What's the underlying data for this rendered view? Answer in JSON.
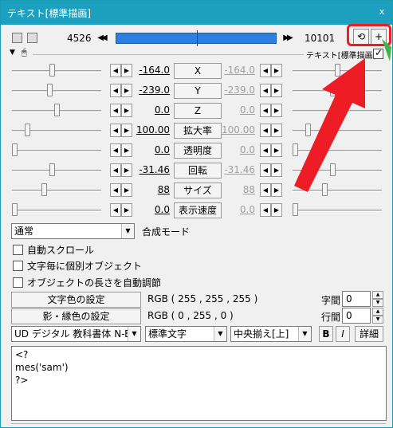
{
  "window": {
    "title": "テキスト[標準描画]",
    "close_glyph": "x"
  },
  "toolbar": {
    "frame_start": "4526",
    "frame_end": "10101",
    "rewind_glyph": "◀◀",
    "forward_glyph": "▶▶",
    "loop_glyph": "⟲",
    "add_glyph": "+"
  },
  "filter_header": {
    "label": "テキスト[標準描画]"
  },
  "params": [
    {
      "name": "X",
      "value": "-164.0",
      "end_value": "-164.0",
      "left_level": 0.45,
      "right_level": 0.5
    },
    {
      "name": "Y",
      "value": "-239.0",
      "end_value": "-239.0",
      "left_level": 0.42,
      "right_level": 0.45
    },
    {
      "name": "Z",
      "value": "0.0",
      "end_value": "0.0",
      "left_level": 0.5,
      "right_level": 0.5
    },
    {
      "name": "拡大率",
      "value": "100.00",
      "end_value": "100.00",
      "left_level": 0.15,
      "right_level": 0.15
    },
    {
      "name": "透明度",
      "value": "0.0",
      "end_value": "0.0",
      "left_level": 0.0,
      "right_level": 0.0
    },
    {
      "name": "回転",
      "value": "-31.46",
      "end_value": "-31.46",
      "left_level": 0.45,
      "right_level": 0.45
    },
    {
      "name": "サイズ",
      "value": "88",
      "end_value": "88",
      "left_level": 0.35,
      "right_level": 0.35
    },
    {
      "name": "表示速度",
      "value": "0.0",
      "end_value": "0.0",
      "left_level": 0.0,
      "right_level": 0.0
    }
  ],
  "blend": {
    "selected": "通常",
    "label": "合成モード"
  },
  "checkboxes": [
    {
      "label": "自動スクロール",
      "checked": false
    },
    {
      "label": "文字毎に個別オブジェクト",
      "checked": false
    },
    {
      "label": "オブジェクトの長さを自動調節",
      "checked": false
    }
  ],
  "colors": {
    "text_button": "文字色の設定",
    "text_rgb": "RGB ( 255 , 255 , 255 )",
    "shadow_button": "影・縁色の設定",
    "shadow_rgb": "RGB ( 0 , 255 , 0 )",
    "char_spacing_label": "字間",
    "char_spacing_value": "0",
    "line_spacing_label": "行間",
    "line_spacing_value": "0"
  },
  "font_row": {
    "font": "UD デジタル 教科書体 N-B",
    "style": "標準文字",
    "align": "中央揃え[上]",
    "bold": "B",
    "italic": "I",
    "detail": "詳細"
  },
  "editor": {
    "text": "<?\nmes('sam')\n?>"
  },
  "accent_colors": {
    "titlebar": "#1ba1bf",
    "timeline": "#2d7fe0",
    "highlight": "#ee1c25"
  }
}
